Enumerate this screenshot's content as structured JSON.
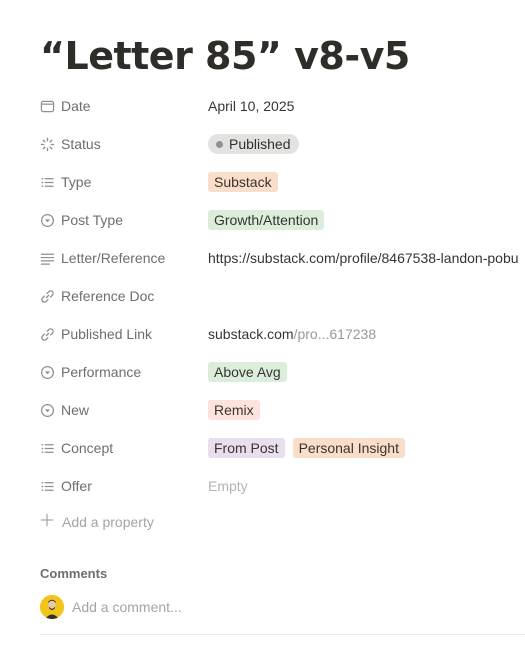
{
  "page": {
    "title": "“Letter 85” v8-v5"
  },
  "properties": {
    "date": {
      "label": "Date",
      "value": "April 10, 2025"
    },
    "status": {
      "label": "Status",
      "value": "Published"
    },
    "type": {
      "label": "Type",
      "value": "Substack"
    },
    "post_type": {
      "label": "Post Type",
      "value": "Growth/Attention"
    },
    "letter_reference": {
      "label": "Letter/Reference",
      "value": "https://substack.com/profile/8467538-landon-pobu"
    },
    "reference_doc": {
      "label": "Reference Doc",
      "value": ""
    },
    "published_link": {
      "label": "Published Link",
      "domain": "substack.com",
      "rest": "/pro...617238"
    },
    "performance": {
      "label": "Performance",
      "value": "Above Avg"
    },
    "new": {
      "label": "New",
      "value": "Remix"
    },
    "concept": {
      "label": "Concept",
      "values": [
        "From Post",
        "Personal Insight"
      ]
    },
    "offer": {
      "label": "Offer",
      "value": "Empty"
    }
  },
  "add_property": {
    "label": "Add a property"
  },
  "comments": {
    "label": "Comments",
    "placeholder": "Add a comment..."
  },
  "colors": {
    "orange_tag": "#fadec9",
    "green_tag": "#dbeddb",
    "red_tag": "#ffe2dd",
    "purple_tag": "#e8deee",
    "status_pill": "#e3e2e0"
  },
  "icons": {
    "date": "calendar-icon",
    "status": "loader-icon",
    "type": "list-icon",
    "post_type": "select-icon",
    "letter_reference": "text-lines-icon",
    "reference_doc": "link-icon",
    "published_link": "link-icon",
    "performance": "select-icon",
    "new": "select-icon",
    "concept": "list-icon",
    "offer": "list-icon",
    "add": "plus-icon"
  }
}
